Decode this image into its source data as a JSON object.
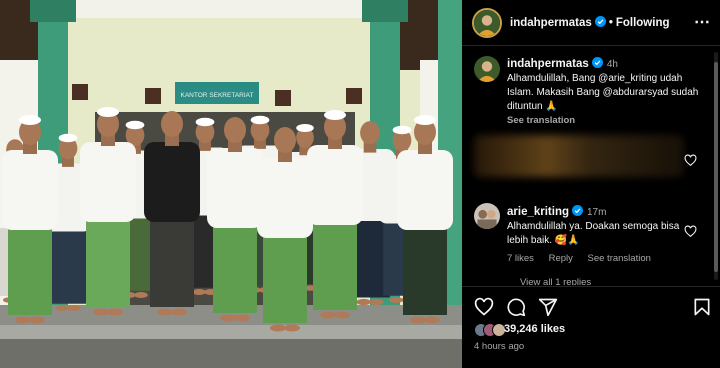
{
  "post": {
    "username": "indahpermatas",
    "follow_status": "Following",
    "more_icon": "more-horizontal-icon",
    "sign_text": "KANTOR SEKRETARIAT"
  },
  "caption": {
    "username": "indahpermatas",
    "time": "4h",
    "text": "Alhamdulillah, Bang @arie_kriting udah Islam. Makasih Bang @abdurarsyad sudah dituntun 🙏",
    "translate": "See translation"
  },
  "reply": {
    "username": "arie_kriting",
    "time": "17m",
    "text": "Alhamdulillah ya. Doakan semoga bisa lebih baik. 🥰🙏",
    "likes": "7 likes",
    "reply_label": "Reply",
    "translate": "See translation"
  },
  "view_replies": "View all 1 replies",
  "actions": {
    "like_icon": "heart-icon",
    "comment_icon": "comment-icon",
    "share_icon": "share-icon",
    "save_icon": "bookmark-icon",
    "likes_count": "39,246 likes",
    "time_ago": "4 hours ago"
  },
  "colors": {
    "background": "#000000",
    "verified": "#0095f6",
    "secondary_text": "#a8a8a8",
    "wall": "#e6eac9",
    "pillar": "#3f9c7a",
    "sarong_green": "#5f9e4e"
  }
}
